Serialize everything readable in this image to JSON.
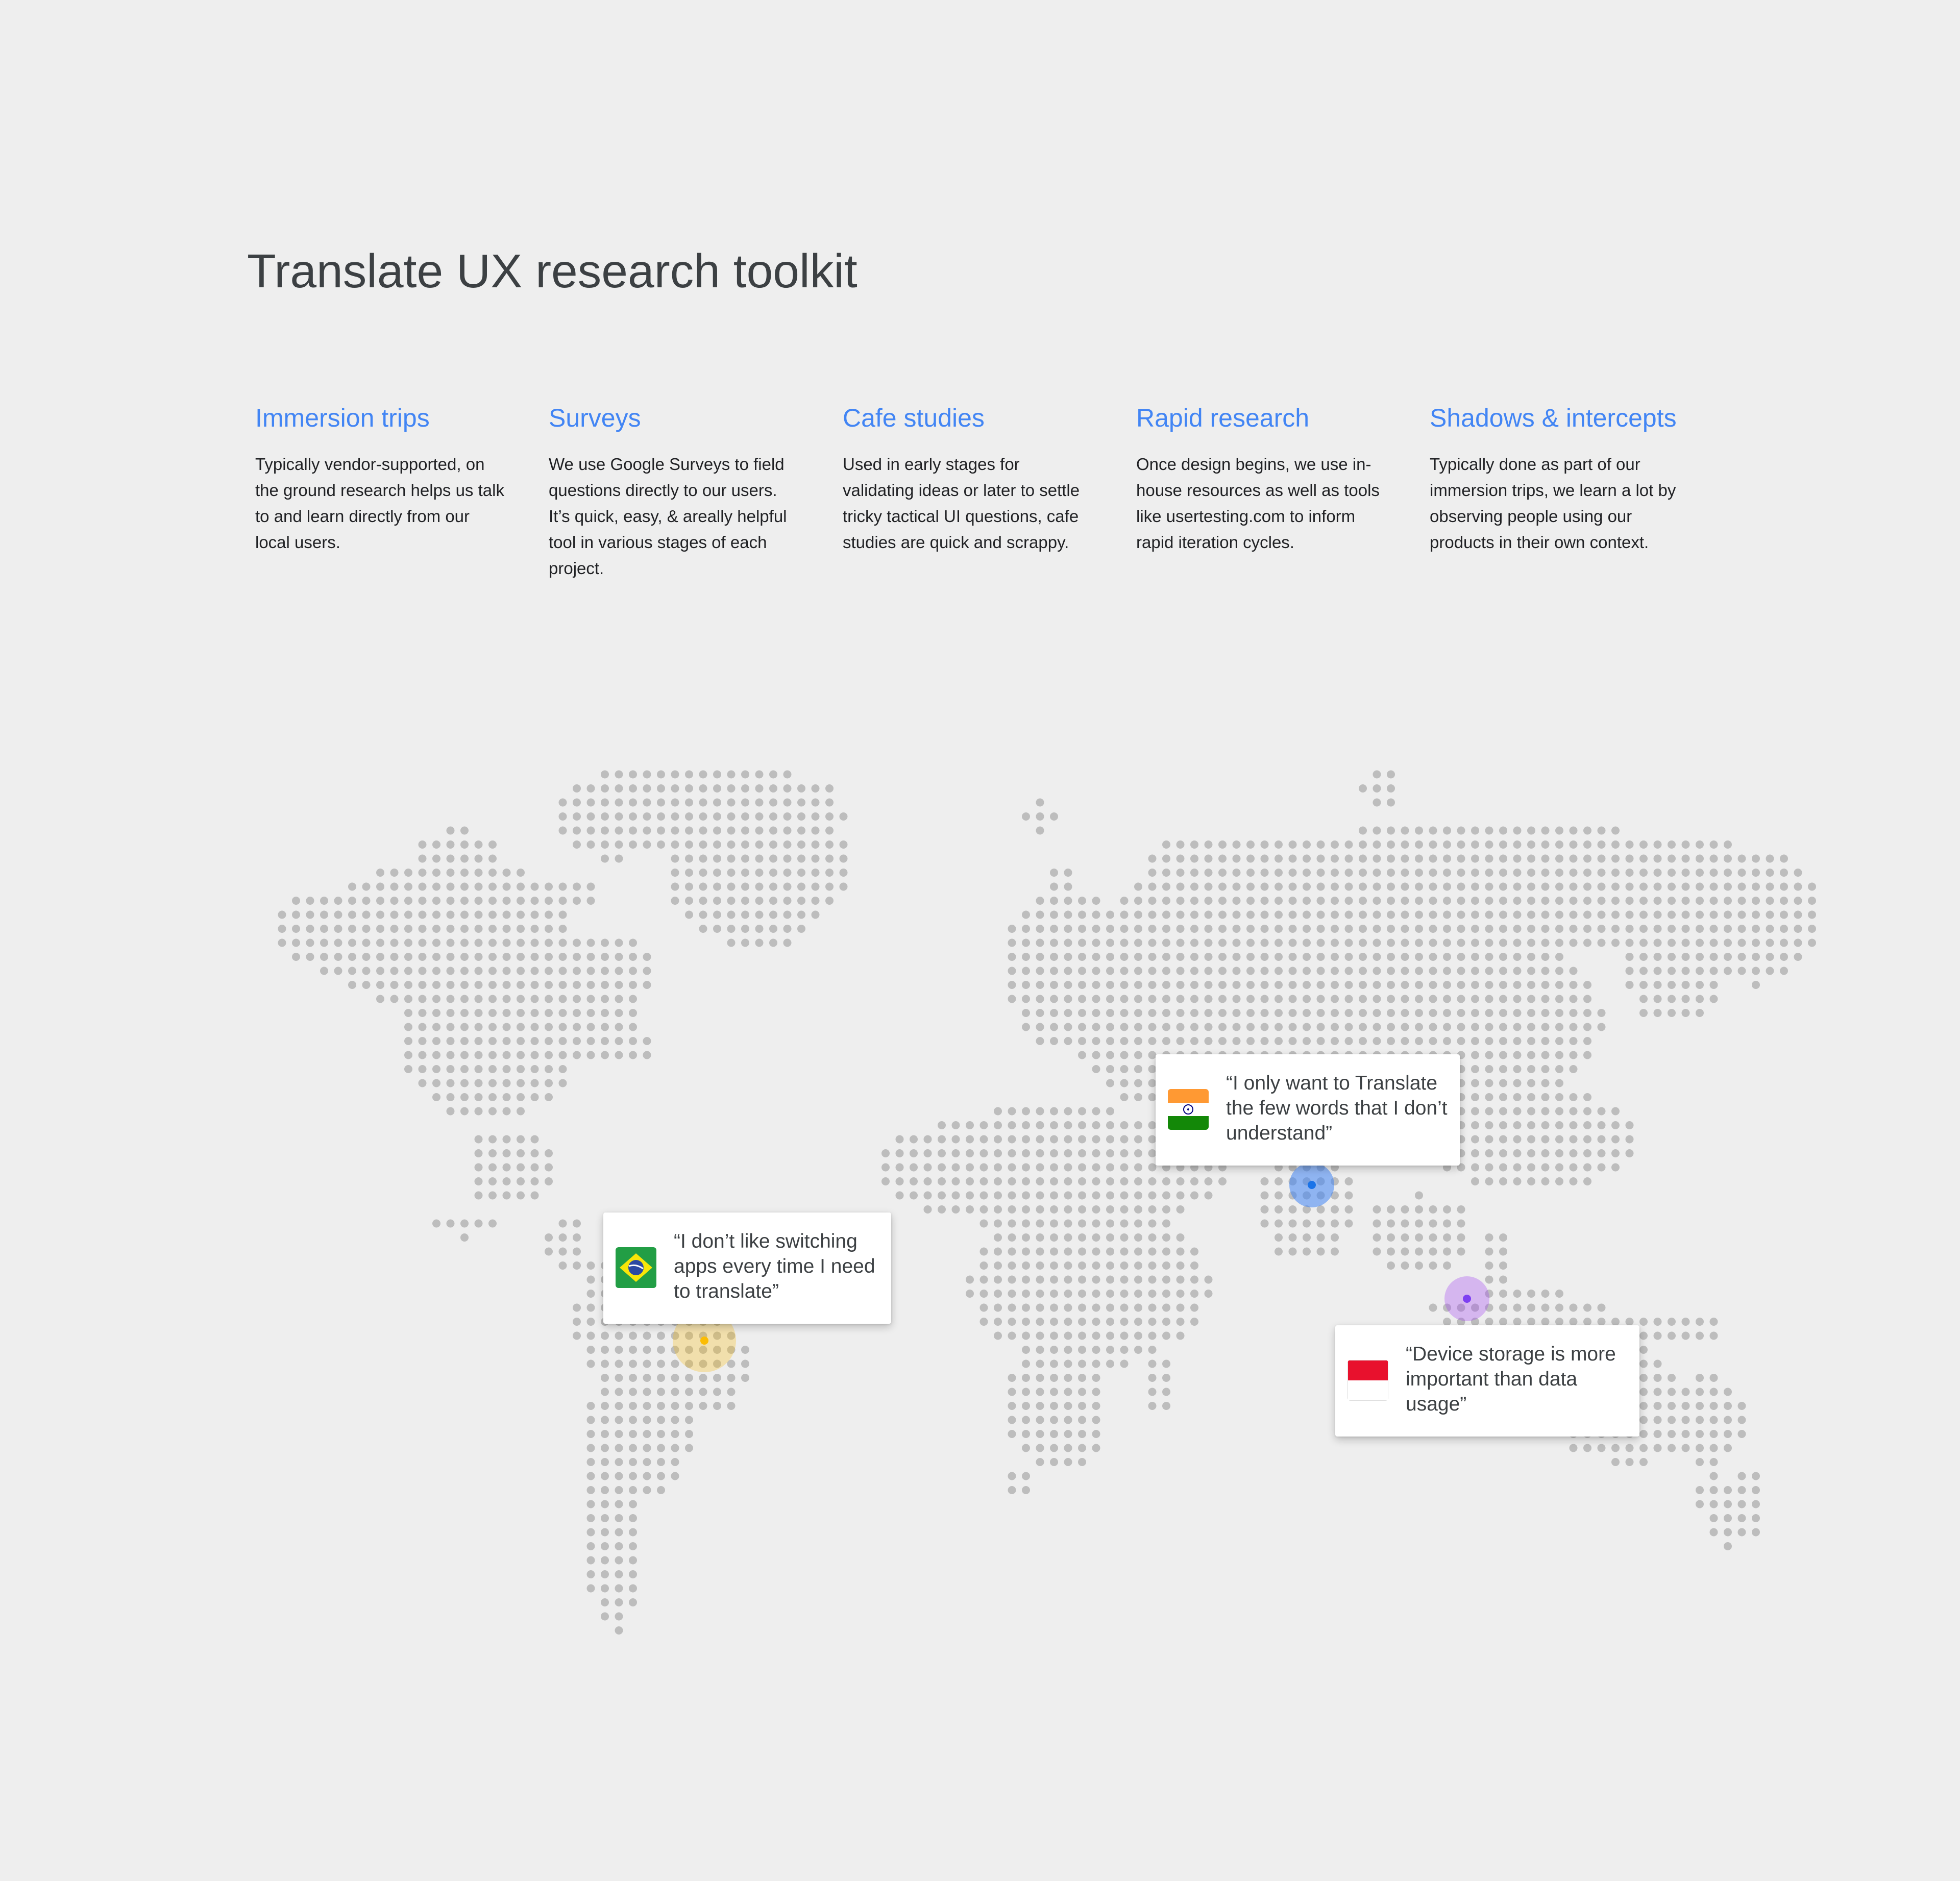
{
  "title": "Translate UX research toolkit",
  "methods": [
    {
      "title": "Immersion trips",
      "description": "Typically vendor-supported, on the ground research helps us talk to and learn directly from our local users."
    },
    {
      "title": "Surveys",
      "description": "We use Google Surveys to field questions directly to our users. It’s quick, easy, & areally helpful tool in various stages of each project."
    },
    {
      "title": "Cafe studies",
      "description": "Used in early stages for validating ideas or later to settle tricky tactical UI questions, cafe studies are quick and scrappy."
    },
    {
      "title": "Rapid research",
      "description": "Once design begins, we use in-house resources as well as tools like usertesting.com to inform rapid iteration cycles."
    },
    {
      "title": "Shadows & intercepts",
      "description": "Typically done as part of our immersion trips, we learn a lot by observing people using our products in their own context."
    }
  ],
  "callouts": [
    {
      "country": "Brazil",
      "quote": "“I don’t like switching apps every time I need to translate”",
      "marker_color": "#fbbc04",
      "flag_icon": "brazil-flag-icon"
    },
    {
      "country": "India",
      "quote": "“I only want to Translate the few words that I don’t understand”",
      "marker_color": "#4285f4",
      "flag_icon": "india-flag-icon"
    },
    {
      "country": "Indonesia",
      "quote": "“Device storage is more important than data usage”",
      "marker_color": "#a142f4",
      "flag_icon": "indonesia-flag-icon"
    }
  ],
  "colors": {
    "accent": "#4285f4",
    "title_text": "#3c4043",
    "body_text": "#202124",
    "map_dot": "#bdbdbd",
    "background": "#eeeeee"
  }
}
